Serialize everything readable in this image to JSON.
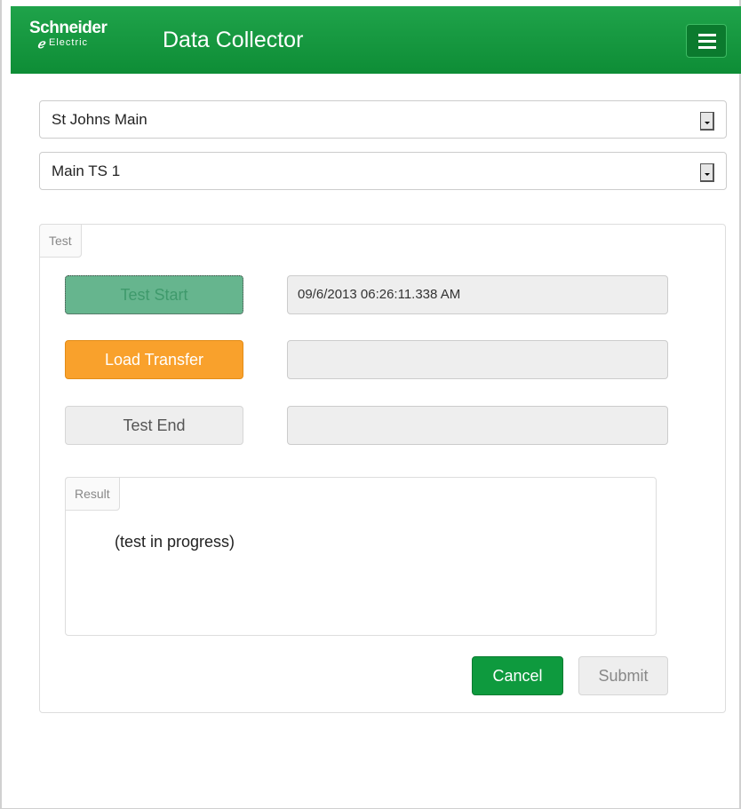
{
  "header": {
    "logo_top": "Schneider",
    "logo_bottom": "Electric",
    "title": "Data Collector",
    "menu_icon": "hamburger-menu-icon"
  },
  "selects": {
    "site": "St Johns Main",
    "switch": "Main TS 1"
  },
  "test": {
    "tab_label": "Test",
    "start_label": "Test Start",
    "start_value": "09/6/2013 06:26:11.338 AM",
    "load_label": "Load Transfer",
    "load_value": "",
    "end_label": "Test End",
    "end_value": "",
    "result_tab": "Result",
    "result_text": "(test in progress)",
    "cancel_label": "Cancel",
    "submit_label": "Submit"
  },
  "colors": {
    "brand_green": "#1fa34a",
    "load_orange": "#f9a12c",
    "start_green": "#66b58e"
  }
}
